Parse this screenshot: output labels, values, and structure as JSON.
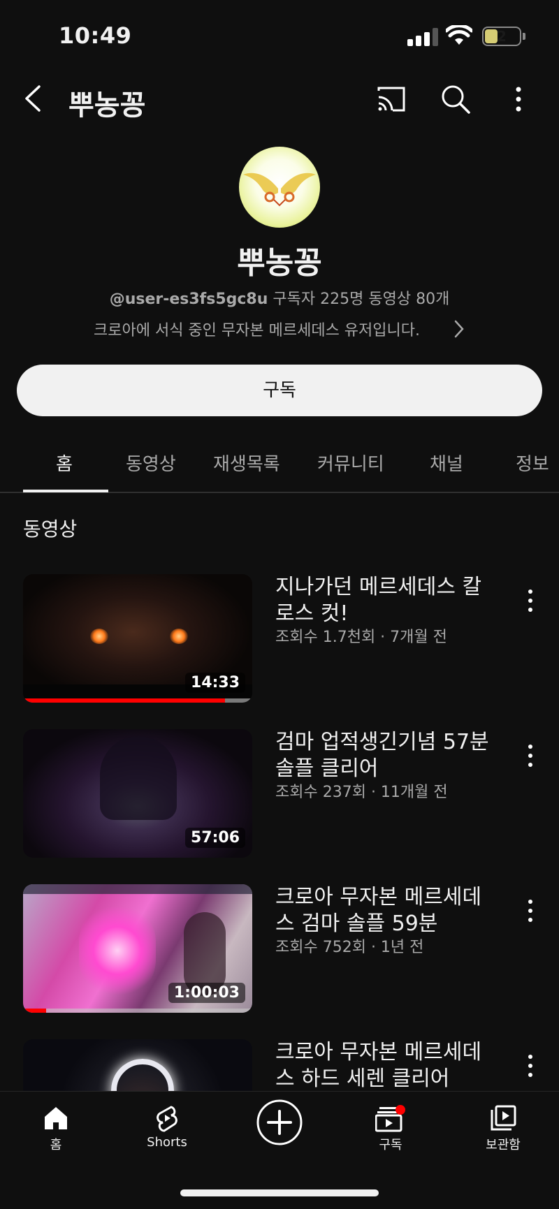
{
  "status_bar": {
    "time": "10:49",
    "battery": "2"
  },
  "header": {
    "title": "뿌농꽁"
  },
  "channel": {
    "name": "뿌농꽁",
    "handle": "@user-es3fs5gc8u",
    "subscribers": "구독자 225명",
    "video_count": "동영상 80개",
    "description": "크로아에 서식 중인 무자본 메르세데스 유저입니다."
  },
  "subscribe_label": "구독",
  "tabs": [
    {
      "label": "홈"
    },
    {
      "label": "동영상"
    },
    {
      "label": "재생목록"
    },
    {
      "label": "커뮤니티"
    },
    {
      "label": "채널"
    },
    {
      "label": "정보"
    }
  ],
  "section_title": "동영상",
  "videos": [
    {
      "title_line1": "지나가던 메르세데스 칼",
      "title_line2": "로스 컷!",
      "meta": "조회수 1.7천회 · 7개월 전",
      "duration": "14:33",
      "progress": 0.88
    },
    {
      "title_line1": "검마 업적생긴기념 57분",
      "title_line2": "솔플 클리어",
      "meta": "조회수 237회 · 11개월 전",
      "duration": "57:06",
      "progress": 0
    },
    {
      "title_line1": "크로아 무자본 메르세데",
      "title_line2": "스 검마 솔플 59분",
      "meta": "조회수 752회 · 1년 전",
      "duration": "1:00:03",
      "progress": 0.1
    },
    {
      "title_line1": "크로아 무자본 메르세데",
      "title_line2": "스 하드 세렌 클리어",
      "meta": "",
      "duration": "",
      "progress": 0
    }
  ],
  "bottom_nav": [
    {
      "label": "홈"
    },
    {
      "label": "Shorts"
    },
    {
      "label": ""
    },
    {
      "label": "구독"
    },
    {
      "label": "보관함"
    }
  ],
  "colors": {
    "background": "#0f0f0f",
    "text": "#f1f1f1",
    "secondary": "#aaaaaa",
    "accent": "#ff0000"
  }
}
